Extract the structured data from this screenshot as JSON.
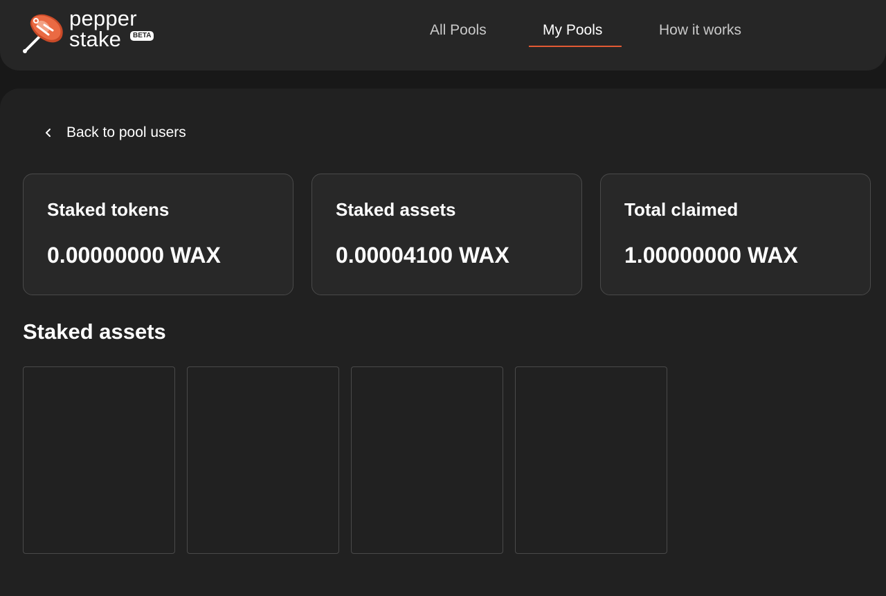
{
  "header": {
    "logo": {
      "line1": "pepper",
      "line2": "stake",
      "badge": "BETA"
    },
    "nav": [
      {
        "label": "All Pools",
        "active": false
      },
      {
        "label": "My Pools",
        "active": true
      },
      {
        "label": "How it works",
        "active": false
      }
    ]
  },
  "main": {
    "back_label": "Back to pool users",
    "stats": [
      {
        "label": "Staked tokens",
        "value": "0.00000000 WAX"
      },
      {
        "label": "Staked assets",
        "value": "0.00004100 WAX"
      },
      {
        "label": "Total claimed",
        "value": "1.00000000 WAX"
      }
    ],
    "section_title": "Staked assets",
    "asset_cards_count": 4
  },
  "colors": {
    "accent": "#e35a34",
    "background": "#181818",
    "panel": "#212121",
    "header": "#262626",
    "card_border": "#4a4a4a"
  },
  "icons": {
    "logo": "pepper-steak-icon",
    "back": "chevron-left-icon"
  }
}
